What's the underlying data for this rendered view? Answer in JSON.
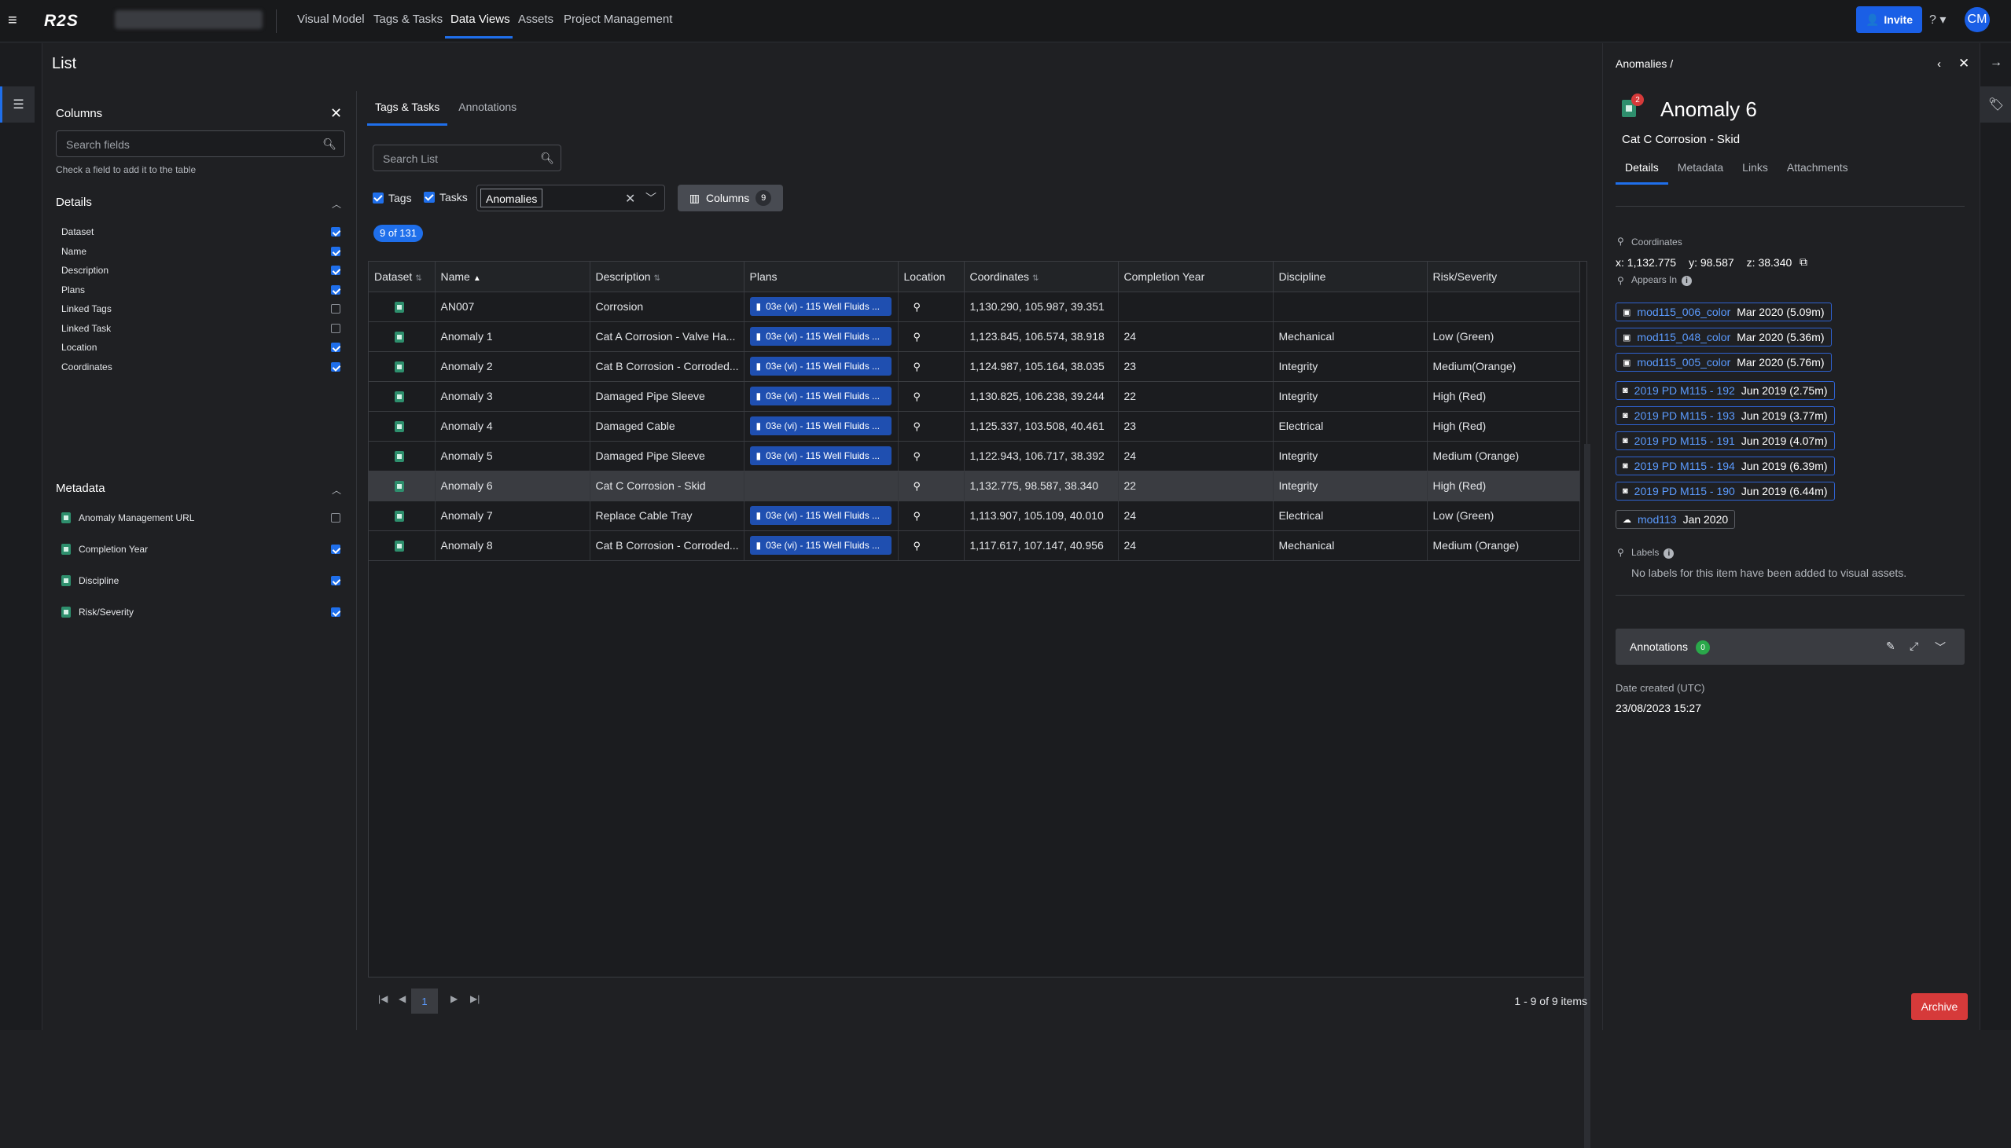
{
  "topbar": {
    "logo": "R2S",
    "nav": [
      {
        "label": "Visual Model"
      },
      {
        "label": "Tags & Tasks"
      },
      {
        "label": "Data Views"
      },
      {
        "label": "Assets"
      },
      {
        "label": "Project Management"
      }
    ],
    "invite_label": "Invite",
    "avatar_initials": "CM",
    "accent": "#1a5fe6"
  },
  "page": {
    "title": "List"
  },
  "columns_panel": {
    "title": "Columns",
    "search_placeholder": "Search fields",
    "hint": "Check a field to add it to the table",
    "details_label": "Details",
    "details": [
      {
        "label": "Dataset",
        "checked": true
      },
      {
        "label": "Name",
        "checked": true
      },
      {
        "label": "Description",
        "checked": true
      },
      {
        "label": "Plans",
        "checked": true
      },
      {
        "label": "Linked Tags",
        "checked": false
      },
      {
        "label": "Linked Task",
        "checked": false
      },
      {
        "label": "Location",
        "checked": true
      },
      {
        "label": "Coordinates",
        "checked": true
      }
    ],
    "metadata_label": "Metadata",
    "metadata": [
      {
        "label": "Anomaly Management URL",
        "checked": false
      },
      {
        "label": "Completion Year",
        "checked": true
      },
      {
        "label": "Discipline",
        "checked": true
      },
      {
        "label": "Risk/Severity",
        "checked": true
      }
    ]
  },
  "main": {
    "tabs": [
      {
        "label": "Tags & Tasks"
      },
      {
        "label": "Annotations"
      }
    ],
    "search_placeholder": "Search List",
    "filter_tags": "Tags",
    "filter_tasks": "Tasks",
    "dataset_value": "Anomalies",
    "columns_button": "Columns",
    "columns_count": "9",
    "count_label": "9 of 131",
    "headers": [
      "Dataset",
      "Name",
      "Description",
      "Plans",
      "Location",
      "Coordinates",
      "Completion Year",
      "Discipline",
      "Risk/Severity"
    ],
    "rows": [
      {
        "name": "AN007",
        "description": "Corrosion",
        "plan": "03e (vi) - 115 Well Fluids ...",
        "coordinates": "1,130.290, 105.987, 39.351",
        "year": "",
        "discipline": "",
        "risk": ""
      },
      {
        "name": "Anomaly 1",
        "description": "Cat A Corrosion - Valve Ha...",
        "plan": "03e (vi) - 115 Well Fluids ...",
        "coordinates": "1,123.845, 106.574, 38.918",
        "year": "24",
        "discipline": "Mechanical",
        "risk": "Low (Green)"
      },
      {
        "name": "Anomaly 2",
        "description": "Cat B Corrosion - Corroded...",
        "plan": "03e (vi) - 115 Well Fluids ...",
        "coordinates": "1,124.987, 105.164, 38.035",
        "year": "23",
        "discipline": "Integrity",
        "risk": "Medium(Orange)"
      },
      {
        "name": "Anomaly 3",
        "description": "Damaged Pipe Sleeve",
        "plan": "03e (vi) - 115 Well Fluids ...",
        "coordinates": "1,130.825, 106.238, 39.244",
        "year": "22",
        "discipline": "Integrity",
        "risk": "High (Red)"
      },
      {
        "name": "Anomaly 4",
        "description": "Damaged Cable",
        "plan": "03e (vi) - 115 Well Fluids ...",
        "coordinates": "1,125.337, 103.508, 40.461",
        "year": "23",
        "discipline": "Electrical",
        "risk": "High (Red)"
      },
      {
        "name": "Anomaly 5",
        "description": "Damaged Pipe Sleeve",
        "plan": "03e (vi) - 115 Well Fluids ...",
        "coordinates": "1,122.943, 106.717, 38.392",
        "year": "24",
        "discipline": "Integrity",
        "risk": "Medium (Orange)"
      },
      {
        "name": "Anomaly 6",
        "description": "Cat C Corrosion - Skid",
        "plan": "",
        "coordinates": "1,132.775, 98.587, 38.340",
        "year": "22",
        "discipline": "Integrity",
        "risk": "High (Red)"
      },
      {
        "name": "Anomaly 7",
        "description": "Replace Cable Tray",
        "plan": "03e (vi) - 115 Well Fluids ...",
        "coordinates": "1,113.907, 105.109, 40.010",
        "year": "24",
        "discipline": "Electrical",
        "risk": "Low (Green)"
      },
      {
        "name": "Anomaly 8",
        "description": "Cat B Corrosion - Corroded...",
        "plan": "03e (vi) - 115 Well Fluids ...",
        "coordinates": "1,117.617, 107.147, 40.956",
        "year": "24",
        "discipline": "Mechanical",
        "risk": "Medium (Orange)"
      }
    ],
    "pager_page": "1",
    "pager_info": "1 - 9 of 9 items"
  },
  "detail": {
    "breadcrumb": "Anomalies  /",
    "badge": "2",
    "title": "Anomaly 6",
    "subtitle": "Cat C Corrosion - Skid",
    "tabs": [
      {
        "label": "Details"
      },
      {
        "label": "Metadata"
      },
      {
        "label": "Links"
      },
      {
        "label": "Attachments"
      }
    ],
    "coordinates_label": "Coordinates",
    "x": "x: 1,132.775",
    "y": "y: 98.587",
    "z": "z: 38.340",
    "appears_in_label": "Appears In",
    "models": [
      {
        "name": "mod115_006_color",
        "date": "Mar 2020  (5.09m)"
      },
      {
        "name": "mod115_048_color",
        "date": "Mar 2020  (5.36m)"
      },
      {
        "name": "mod115_005_color",
        "date": "Mar 2020  (5.76m)"
      }
    ],
    "photos": [
      {
        "name": "2019 PD M115 - 192",
        "date": "Jun 2019  (2.75m)"
      },
      {
        "name": "2019 PD M115 - 193",
        "date": "Jun 2019  (3.77m)"
      },
      {
        "name": "2019 PD M115 - 191",
        "date": "Jun 2019  (4.07m)"
      },
      {
        "name": "2019 PD M115 - 194",
        "date": "Jun 2019  (6.39m)"
      },
      {
        "name": "2019 PD M115 - 190",
        "date": "Jun 2019  (6.44m)"
      }
    ],
    "cloud": {
      "name": "mod113",
      "date": "Jan 2020"
    },
    "labels_label": "Labels",
    "no_labels": "No labels for this item have been added to visual assets.",
    "annotations_label": "Annotations",
    "annotations_count": "0",
    "date_created_label": "Date created (UTC)",
    "date_created": "23/08/2023 15:27",
    "archive_label": "Archive"
  }
}
